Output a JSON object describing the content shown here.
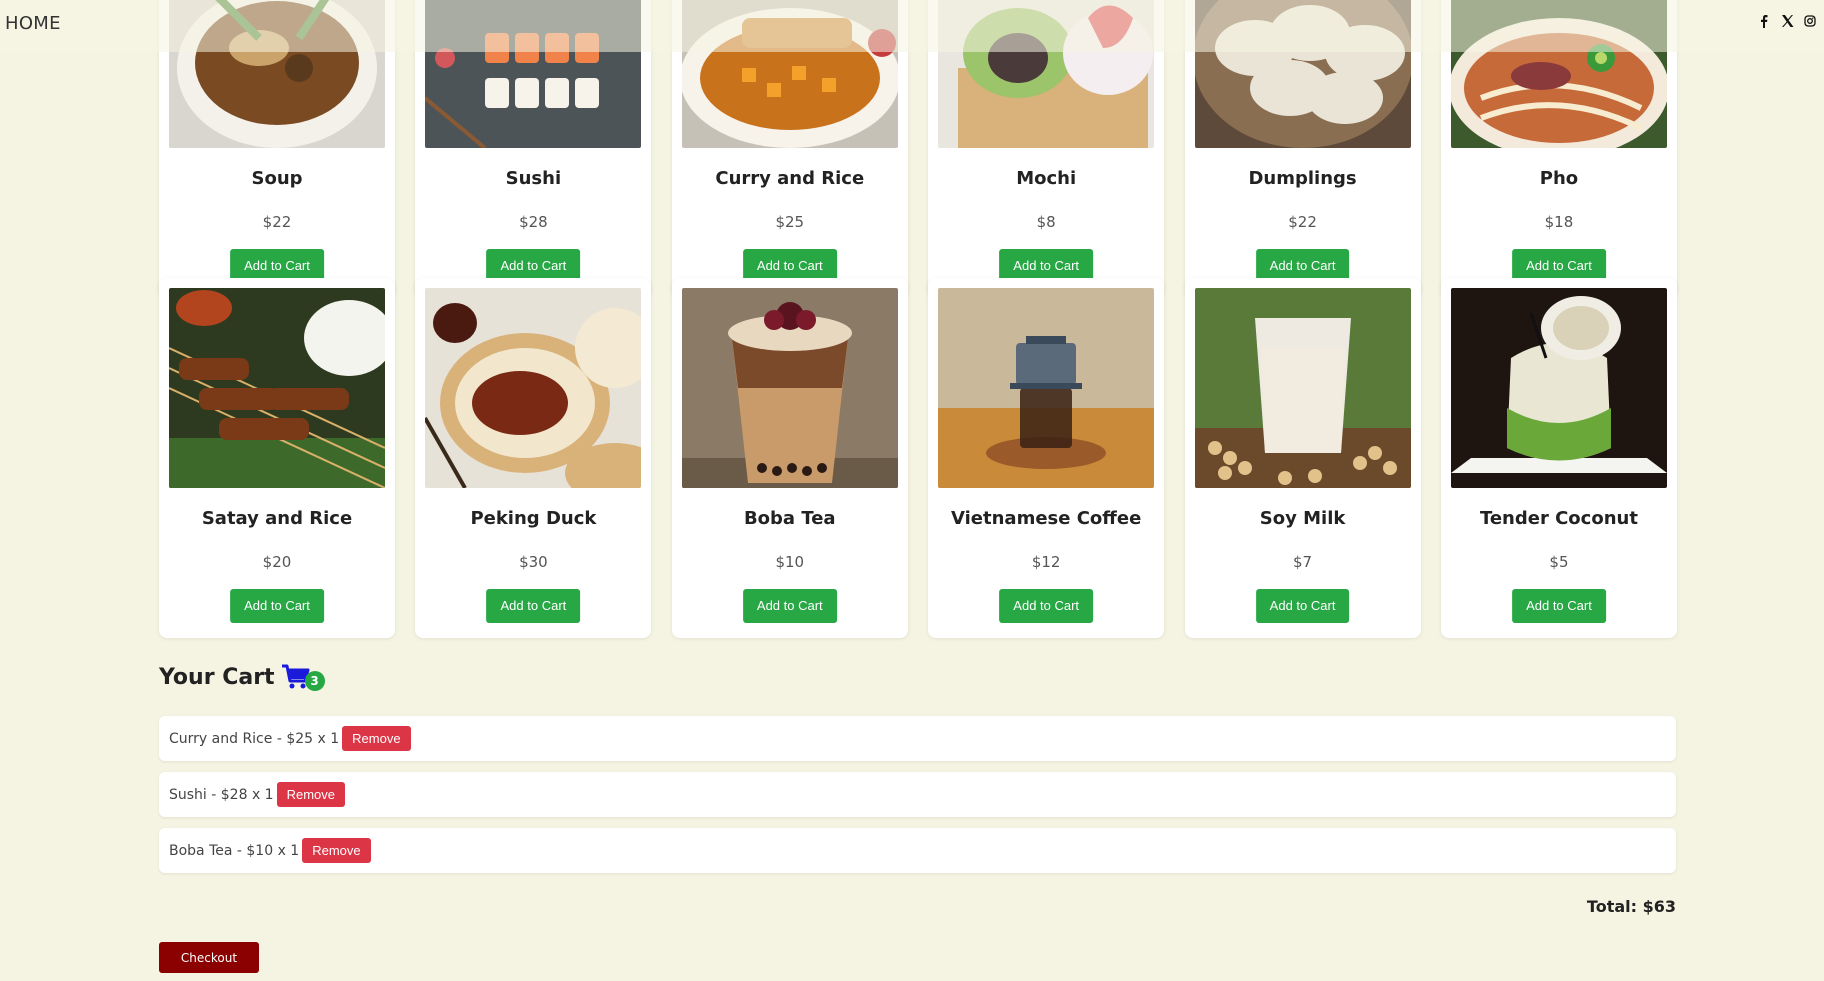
{
  "nav": {
    "home_label": "HOME",
    "social_icons": [
      "facebook-icon",
      "x-icon",
      "instagram-icon"
    ]
  },
  "menu": [
    {
      "name": "Soup",
      "price": "$22",
      "button": "Add to Cart",
      "image": "soup-photo"
    },
    {
      "name": "Sushi",
      "price": "$28",
      "button": "Add to Cart",
      "image": "sushi-photo"
    },
    {
      "name": "Curry and Rice",
      "price": "$25",
      "button": "Add to Cart",
      "image": "curry-photo"
    },
    {
      "name": "Mochi",
      "price": "$8",
      "button": "Add to Cart",
      "image": "mochi-photo"
    },
    {
      "name": "Dumplings",
      "price": "$22",
      "button": "Add to Cart",
      "image": "dumplings-photo"
    },
    {
      "name": "Pho",
      "price": "$18",
      "button": "Add to Cart",
      "image": "pho-photo"
    },
    {
      "name": "Satay and Rice",
      "price": "$20",
      "button": "Add to Cart",
      "image": "satay-photo"
    },
    {
      "name": "Peking Duck",
      "price": "$30",
      "button": "Add to Cart",
      "image": "duck-photo"
    },
    {
      "name": "Boba Tea",
      "price": "$10",
      "button": "Add to Cart",
      "image": "boba-photo"
    },
    {
      "name": "Vietnamese Coffee",
      "price": "$12",
      "button": "Add to Cart",
      "image": "coffee-photo"
    },
    {
      "name": "Soy Milk",
      "price": "$7",
      "button": "Add to Cart",
      "image": "soymilk-photo"
    },
    {
      "name": "Tender Coconut",
      "price": "$5",
      "button": "Add to Cart",
      "image": "coconut-photo"
    }
  ],
  "cart": {
    "title": "Your Cart",
    "count": "3",
    "items": [
      {
        "text": "Curry and Rice - $25 x 1",
        "remove_label": "Remove"
      },
      {
        "text": "Sushi - $28 x 1",
        "remove_label": "Remove"
      },
      {
        "text": "Boba Tea - $10 x 1",
        "remove_label": "Remove"
      }
    ],
    "total": "Total: $63",
    "checkout_label": "Checkout"
  },
  "colors": {
    "background": "#f5f4e2",
    "add_button": "#28a745",
    "remove_button": "#dc3545",
    "checkout_button": "#8b0000",
    "cart_icon": "#1a1adb"
  }
}
